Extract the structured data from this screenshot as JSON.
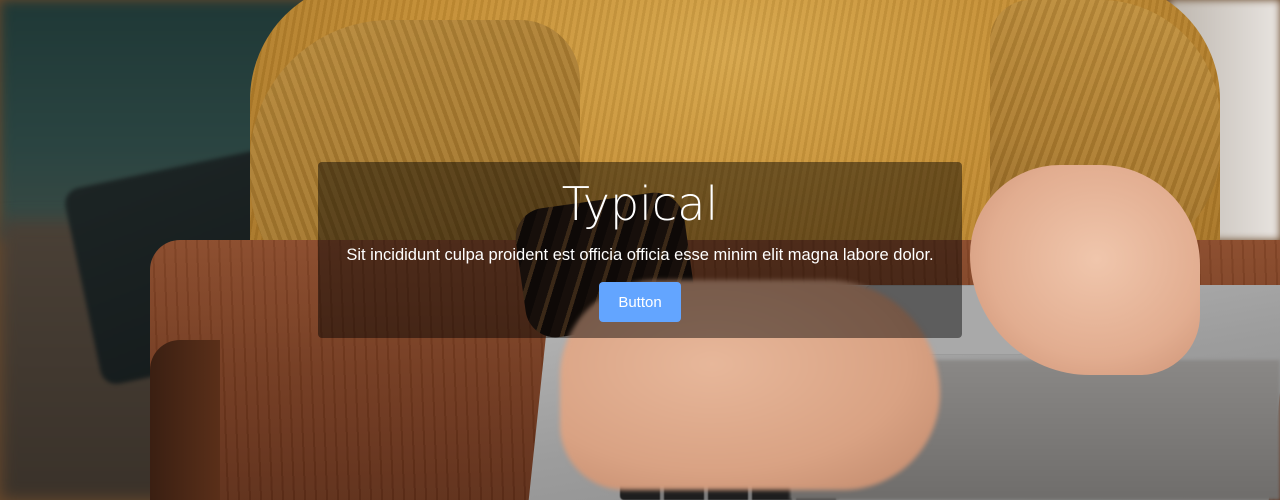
{
  "hero": {
    "title": "Typical",
    "text": "Sit incididunt culpa proident est officia officia esse minim elit magna labore dolor.",
    "button_label": "Button",
    "button_color": "#63a5ff",
    "overlay_color": "rgba(0,0,0,0.45)",
    "background_subject": "person typing on laptop at wooden desk wearing mustard sweater"
  }
}
